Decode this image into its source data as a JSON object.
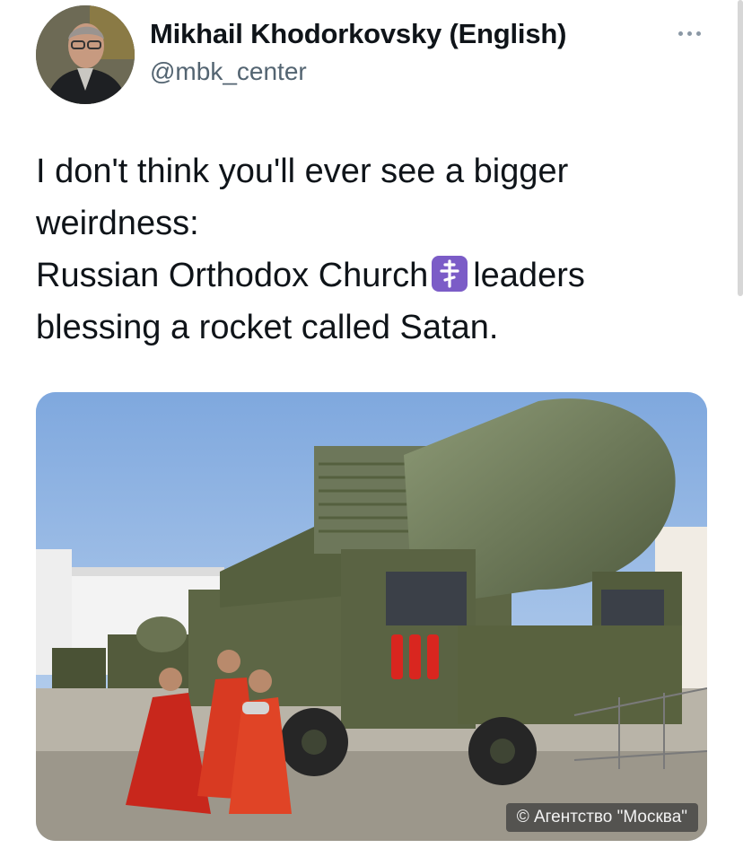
{
  "tweet": {
    "author_name": "Mikhail Khodorkovsky (English)",
    "author_handle": "@mbk_center",
    "lines": [
      "I don't think you'll ever see a bigger",
      "weirdness:",
      "Russian Orthodox Church",
      "leaders",
      "blessing a rocket called Satan."
    ],
    "emoji": "orthodox-cross-emoji",
    "emoji_color": "#7b5cc7"
  },
  "media": {
    "photo_credit": "© Агентство \"Москва\""
  },
  "icons": {
    "more": "more-horizontal-icon"
  }
}
